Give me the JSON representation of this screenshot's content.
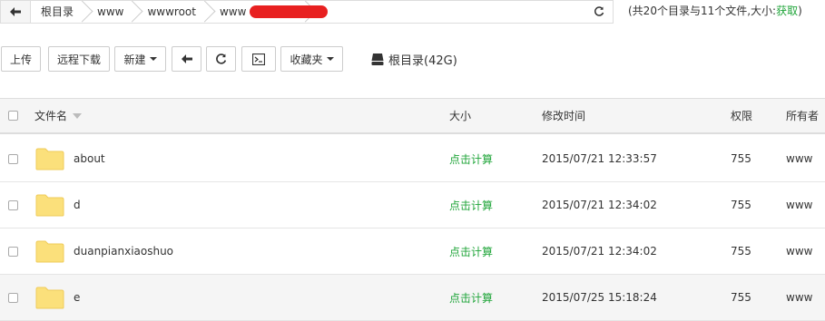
{
  "breadcrumb": {
    "items": [
      "根目录",
      "www",
      "wwwroot",
      "www"
    ]
  },
  "summary": {
    "text": "(共20个目录与11个文件,大小:",
    "fetch_label": "获取",
    "close": ")"
  },
  "toolbar": {
    "upload": "上传",
    "remote_download": "远程下载",
    "new": "新建",
    "favorites": "收藏夹"
  },
  "disk": {
    "label": "根目录(42G)"
  },
  "table": {
    "headers": {
      "name": "文件名",
      "size": "大小",
      "mtime": "修改时间",
      "perm": "权限",
      "owner": "所有者"
    },
    "rows": [
      {
        "name": "about",
        "size": "点击计算",
        "mtime": "2015/07/21 12:33:57",
        "perm": "755",
        "owner": "www"
      },
      {
        "name": "d",
        "size": "点击计算",
        "mtime": "2015/07/21 12:34:02",
        "perm": "755",
        "owner": "www"
      },
      {
        "name": "duanpianxiaoshuo",
        "size": "点击计算",
        "mtime": "2015/07/21 12:34:02",
        "perm": "755",
        "owner": "www"
      },
      {
        "name": "e",
        "size": "点击计算",
        "mtime": "2015/07/25 15:18:24",
        "perm": "755",
        "owner": "www"
      }
    ]
  },
  "colors": {
    "accent_green": "#20a53a",
    "folder_yellow": "#fbe07b",
    "redaction_red": "#e82020"
  }
}
